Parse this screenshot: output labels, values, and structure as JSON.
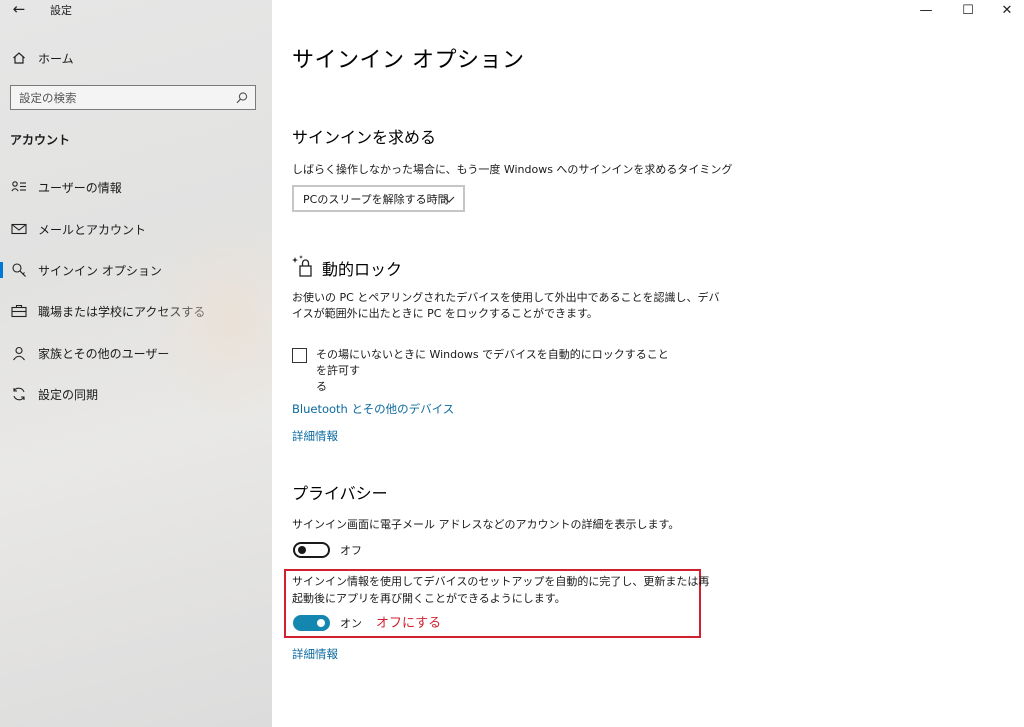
{
  "window": {
    "title": "設定",
    "controls": {
      "minimize": "—",
      "maximize": "☐",
      "close": "✕"
    }
  },
  "sidebar": {
    "home": "ホーム",
    "search": {
      "placeholder": "設定の検索"
    },
    "section": "アカウント",
    "items": [
      {
        "label": "ユーザーの情報",
        "icon": "user-info-icon"
      },
      {
        "label": "メールとアカウント",
        "icon": "mail-icon"
      },
      {
        "label": "サインイン オプション",
        "icon": "key-icon",
        "active": true
      },
      {
        "label": "職場または学校にアクセスする",
        "icon": "briefcase-icon"
      },
      {
        "label": "家族とその他のユーザー",
        "icon": "person-icon"
      },
      {
        "label": "設定の同期",
        "icon": "sync-icon"
      }
    ]
  },
  "main": {
    "title": "サインイン オプション",
    "require_signin": {
      "heading": "サインインを求める",
      "description": "しばらく操作しなかった場合に、もう一度 Windows へのサインインを求めるタイミング",
      "dropdown_value": "PCのスリープを解除する時間"
    },
    "dynamic_lock": {
      "heading": "動的ロック",
      "description_line1": "お使いの PC とペアリングされたデバイスを使用して外出中であることを認識し、デバ",
      "description_line2": "イスが範囲外に出たときに PC をロックすることができます。",
      "checkbox_label_line1": "その場にいないときに Windows でデバイスを自動的にロックすることを許可す",
      "checkbox_label_line2": "る",
      "checkbox_checked": false,
      "link_bluetooth": "Bluetooth とその他のデバイス",
      "link_more": "詳細情報"
    },
    "privacy": {
      "heading": "プライバシー",
      "setting1_description": "サインイン画面に電子メール アドレスなどのアカウントの詳細を表示します。",
      "setting1_state": "オフ",
      "setting2_description_line1": "サインイン情報を使用してデバイスのセットアップを自動的に完了し、更新または再",
      "setting2_description_line2": "起動後にアプリを再び開くことができるようにします。",
      "setting2_state": "オン",
      "annotation": "オフにする",
      "link_more": "詳細情報"
    }
  },
  "colors": {
    "accent": "#0078d7",
    "link": "#0b6a9e",
    "toggle_on": "#1487b0",
    "annotation": "#d2202f"
  }
}
